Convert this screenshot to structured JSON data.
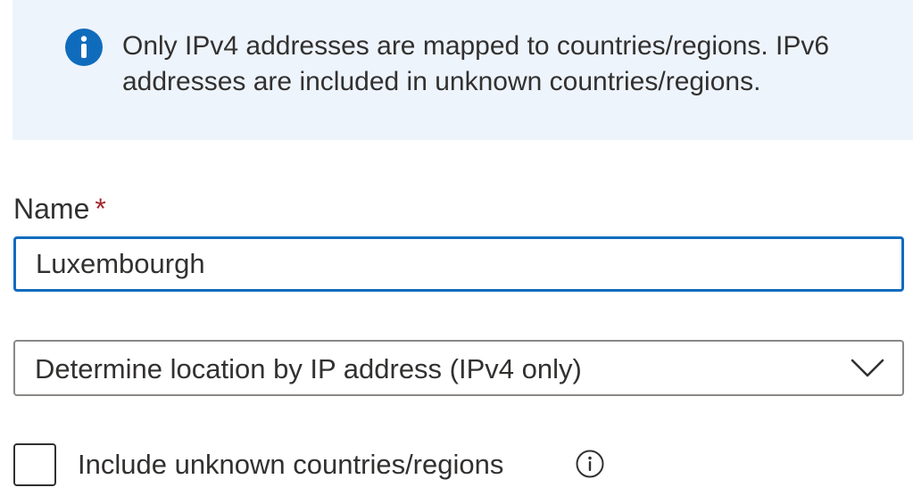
{
  "info_banner": {
    "icon": "info-icon",
    "text": "Only IPv4 addresses are mapped to countries/regions. IPv6 addresses are included in unknown countries/regions."
  },
  "name_field": {
    "label": "Name",
    "required_marker": "*",
    "value": "Luxembourgh"
  },
  "location_dropdown": {
    "selected": "Determine location by IP address (IPv4 only)",
    "icon": "chevron-down-icon"
  },
  "include_unknown": {
    "label": "Include unknown countries/regions",
    "checked": false,
    "info_icon": "info-circle-icon"
  },
  "colors": {
    "banner_background": "#eef4fc",
    "info_icon": "#0f6cbd",
    "input_focus_border": "#0f6cbd",
    "required_star": "#a4262c",
    "text": "#323130"
  }
}
